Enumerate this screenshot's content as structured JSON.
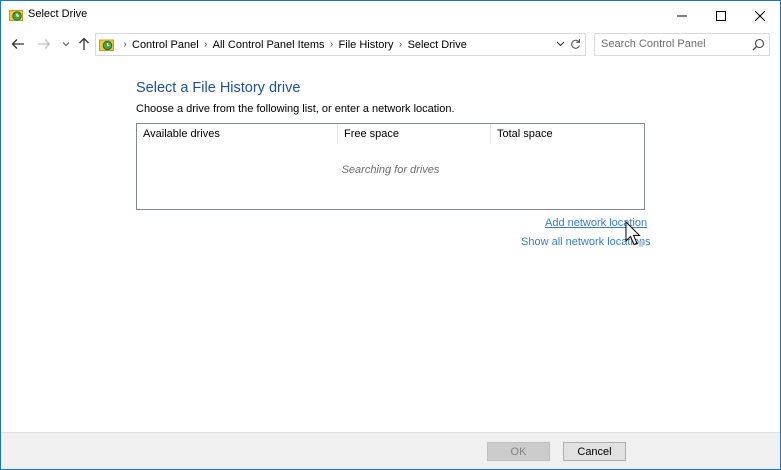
{
  "window": {
    "title": "Select Drive"
  },
  "nav": {
    "breadcrumbs": [
      "Control Panel",
      "All Control Panel Items",
      "File History",
      "Select Drive"
    ],
    "search_placeholder": "Search Control Panel"
  },
  "main": {
    "heading": "Select a File History drive",
    "instruction": "Choose a drive from the following list, or enter a network location.",
    "columns": [
      "Available drives",
      "Free space",
      "Total space"
    ],
    "status": "Searching for drives",
    "add_network_link": "Add network location",
    "show_network_link": "Show all network locations"
  },
  "footer": {
    "ok_label": "OK",
    "cancel_label": "Cancel"
  },
  "icons": {
    "title": "file-history-icon",
    "back": "arrow-left-icon",
    "forward": "arrow-right-icon",
    "recent": "chevron-down-icon",
    "up": "arrow-up-icon",
    "refresh": "refresh-icon",
    "search": "search-icon"
  },
  "colors": {
    "heading": "#1e4e9e",
    "link": "#3a7dc9",
    "window_border": "#1c75bc"
  }
}
